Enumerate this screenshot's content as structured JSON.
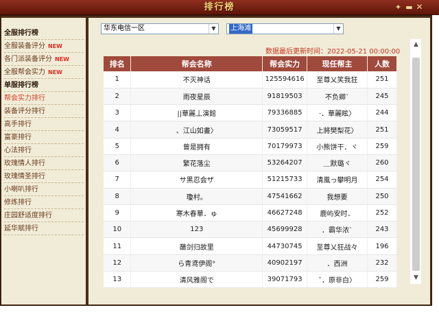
{
  "window": {
    "title": "排行榜",
    "pin_icon": "pin-icon",
    "minimize_icon": "minimize-icon",
    "close_icon": "close-icon",
    "pin_glyph": "✦",
    "minimize_glyph": "▬",
    "close_glyph": "✕",
    "accent_color": "#8e2f1f",
    "title_color": "#f3d57a"
  },
  "sidebar": {
    "sections": [
      {
        "label": "全服排行榜",
        "header": true
      },
      {
        "label": "全服装备评分",
        "new": "NEW"
      },
      {
        "label": "各门派装备评分",
        "new": "NEW"
      },
      {
        "label": "全服帮会实力",
        "new": "NEW"
      },
      {
        "label": "单服排行榜",
        "header": true
      },
      {
        "label": "帮会实力排行",
        "active": true
      },
      {
        "label": "装备评分排行"
      },
      {
        "label": "高手排行"
      },
      {
        "label": "富豪排行"
      },
      {
        "label": "心法排行"
      },
      {
        "label": "玫瑰情人排行"
      },
      {
        "label": "玫瑰情圣排行"
      },
      {
        "label": "小喇叭排行"
      },
      {
        "label": "修炼排行"
      },
      {
        "label": "庄园舒适度排行"
      },
      {
        "label": "延华赋排行"
      }
    ]
  },
  "filters": {
    "server": "华东电信一区",
    "region": "上海滩",
    "arrow": "▼"
  },
  "update_label": "数据最后更新时间：2022-05-21 00:00:00",
  "table": {
    "headers": [
      "排名",
      "帮会名称",
      "帮会实力",
      "现任帮主",
      "人数"
    ],
    "rows": [
      [
        "1",
        "不灭神话",
        "125594616",
        "至尊乂笑我狂",
        "251"
      ],
      [
        "2",
        "雨夜星辰",
        "91819503",
        "不负卿`",
        "245"
      ],
      [
        "3",
        "||華麗丄演館",
        "79336885",
        "·．華麗眩〉",
        "244"
      ],
      [
        "4",
        "、江山如畫〉",
        "73059517",
        "上將樊梨花〉",
        "251"
      ],
      [
        "5",
        "曾是拥有",
        "70179973",
        "小熊饼干．ヾ",
        "259"
      ],
      [
        "6",
        "繁花落尘",
        "53264207",
        "＿默璐ヾ",
        "260"
      ],
      [
        "7",
        "サ黑忍会ザ",
        "51215733",
        "清風っ攀明月",
        "254"
      ],
      [
        "8",
        "瓊村。",
        "47541662",
        "我想要",
        "250"
      ],
      [
        "9",
        "寒木春華．ゅ",
        "46627248",
        "鹿屿安时．",
        "252"
      ],
      [
        "10",
        "123",
        "45699928",
        "．霸华浓`",
        "243"
      ],
      [
        "11",
        "蘸剑归故里",
        "44730745",
        "至尊乂狂战々",
        "196"
      ],
      [
        "12",
        "ら青鸢伊阁°",
        "40902197",
        "．西洲",
        "232"
      ],
      [
        "13",
        "清风雅阁で",
        "39071793",
        "˘．原非白〉",
        "259"
      ]
    ]
  },
  "scrollbar": {
    "up": "▲",
    "down": "▼",
    "thumb_fraction": 0.87
  }
}
